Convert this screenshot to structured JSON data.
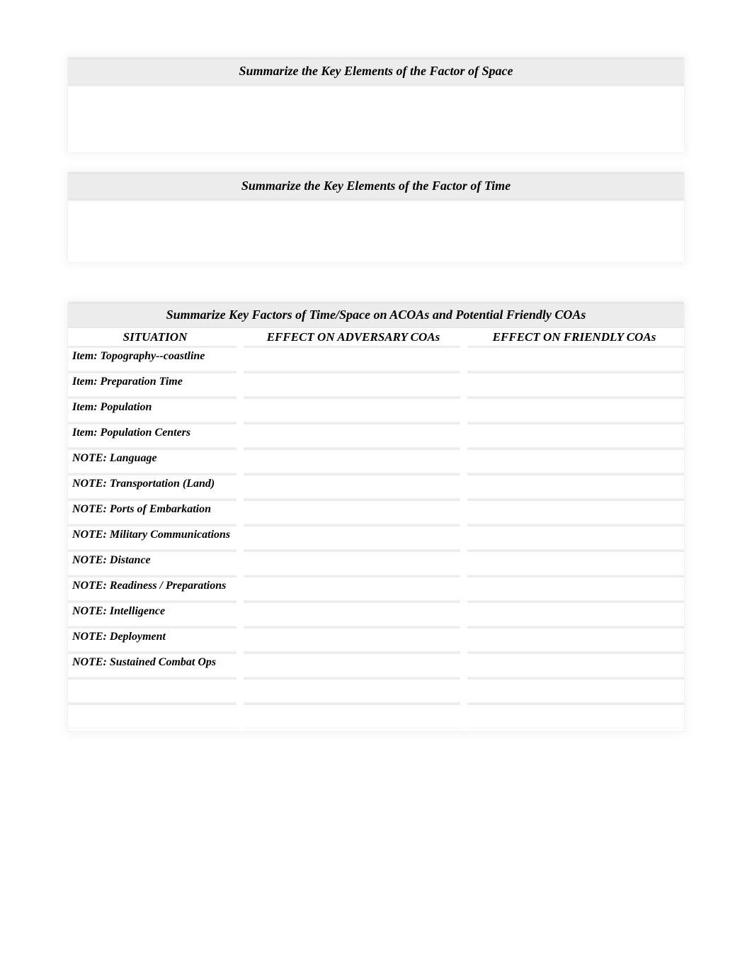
{
  "sections": {
    "space": {
      "title": "Summarize the Key Elements of the Factor of Space",
      "body": ""
    },
    "time": {
      "title": "Summarize the Key Elements of the Factor of Time",
      "body": ""
    }
  },
  "matrix": {
    "title": "Summarize Key Factors of Time/Space on ACOAs and Potential Friendly COAs",
    "headers": {
      "situation": "SITUATION",
      "adversary": "EFFECT ON ADVERSARY COAs",
      "friendly": "EFFECT ON FRIENDLY COAs"
    },
    "rows": [
      {
        "label": "Item:  Topography--coastline",
        "adv": "",
        "fri": ""
      },
      {
        "label": "Item: Preparation Time",
        "adv": "",
        "fri": ""
      },
      {
        "label": "Item: Population",
        "adv": "",
        "fri": ""
      },
      {
        "label": "Item: Population Centers",
        "adv": "",
        "fri": ""
      },
      {
        "label": "NOTE:  Language",
        "adv": "",
        "fri": ""
      },
      {
        "label": "NOTE:  Transportation (Land)",
        "adv": "",
        "fri": ""
      },
      {
        "label": "NOTE:  Ports of Embarkation",
        "adv": "",
        "fri": ""
      },
      {
        "label": "NOTE:  Military Communications",
        "adv": "",
        "fri": ""
      },
      {
        "label": "NOTE:  Distance",
        "adv": "",
        "fri": ""
      },
      {
        "label": "NOTE:  Readiness / Preparations",
        "adv": "",
        "fri": ""
      },
      {
        "label": "NOTE:  Intelligence",
        "adv": "",
        "fri": ""
      },
      {
        "label": "NOTE:  Deployment",
        "adv": "",
        "fri": ""
      },
      {
        "label": "NOTE:  Sustained Combat Ops",
        "adv": "",
        "fri": ""
      },
      {
        "label": "",
        "adv": "",
        "fri": ""
      },
      {
        "label": "",
        "adv": "",
        "fri": ""
      }
    ]
  }
}
